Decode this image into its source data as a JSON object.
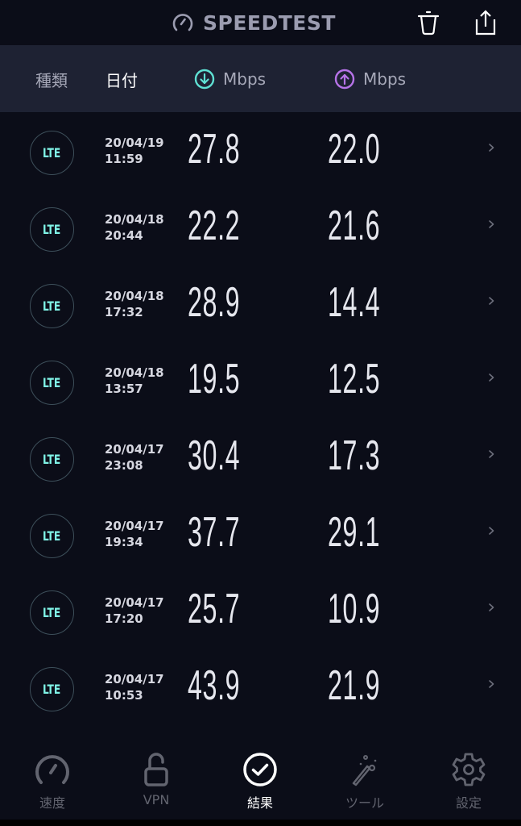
{
  "app": {
    "title": "SPEEDTEST",
    "brand_icon": "speedometer-icon",
    "actions": [
      {
        "name": "delete",
        "icon": "trash-icon"
      },
      {
        "name": "share",
        "icon": "share-icon"
      }
    ]
  },
  "columns": {
    "type": "種類",
    "date": "日付",
    "download": {
      "label": "Mbps",
      "icon": "download-arrow-icon",
      "color": "#5fe0d3"
    },
    "upload": {
      "label": "Mbps",
      "icon": "upload-arrow-icon",
      "color": "#b673e8"
    }
  },
  "results": [
    {
      "type": "LTE",
      "date": "20/04/19",
      "time": "11:59",
      "download": "27.8",
      "upload": "22.0"
    },
    {
      "type": "LTE",
      "date": "20/04/18",
      "time": "20:44",
      "download": "22.2",
      "upload": "21.6"
    },
    {
      "type": "LTE",
      "date": "20/04/18",
      "time": "17:32",
      "download": "28.9",
      "upload": "14.4"
    },
    {
      "type": "LTE",
      "date": "20/04/18",
      "time": "13:57",
      "download": "19.5",
      "upload": "12.5"
    },
    {
      "type": "LTE",
      "date": "20/04/17",
      "time": "23:08",
      "download": "30.4",
      "upload": "17.3"
    },
    {
      "type": "LTE",
      "date": "20/04/17",
      "time": "19:34",
      "download": "37.7",
      "upload": "29.1"
    },
    {
      "type": "LTE",
      "date": "20/04/17",
      "time": "17:20",
      "download": "25.7",
      "upload": "10.9"
    },
    {
      "type": "LTE",
      "date": "20/04/17",
      "time": "10:53",
      "download": "43.9",
      "upload": "21.9"
    }
  ],
  "nav": [
    {
      "label": "速度",
      "icon": "speedometer-icon",
      "active": false
    },
    {
      "label": "VPN",
      "icon": "unlock-icon",
      "active": false
    },
    {
      "label": "結果",
      "icon": "check-circle-icon",
      "active": true
    },
    {
      "label": "ツール",
      "icon": "magic-wand-icon",
      "active": false
    },
    {
      "label": "設定",
      "icon": "gear-icon",
      "active": false
    }
  ],
  "colors": {
    "background": "#0b0d18",
    "header_bar": "#1e2233",
    "lte_text": "#7ff3e6",
    "download_accent": "#5fe0d3",
    "upload_accent": "#b673e8"
  }
}
